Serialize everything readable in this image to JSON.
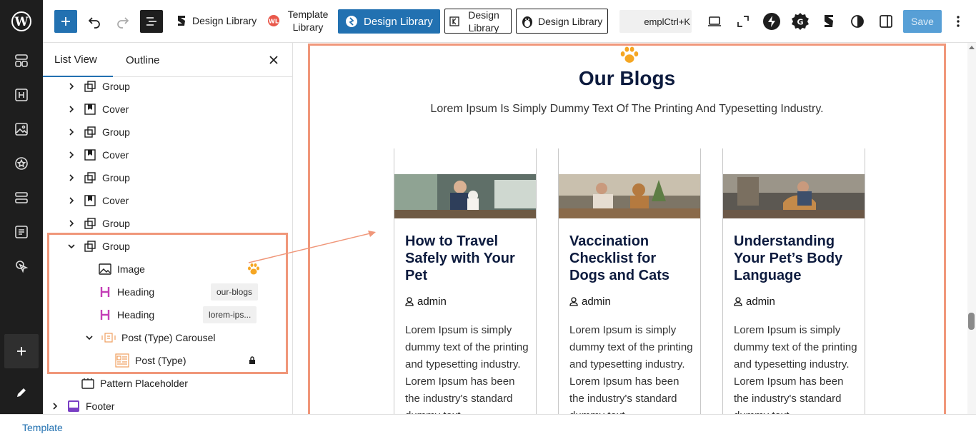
{
  "toolbar": {
    "design_library_1": "Design Library",
    "template_library": "Template Library",
    "design_library_blue": "Design Library",
    "design_library_box": "Design Library",
    "design_library_3": "Design Library",
    "search_text": "empl",
    "search_shortcut": "Ctrl+K",
    "save_label": "Save"
  },
  "list_view": {
    "tab_list": "List View",
    "tab_outline": "Outline",
    "items": [
      {
        "label": "Group",
        "icon": "group-icon"
      },
      {
        "label": "Cover",
        "icon": "cover-icon"
      },
      {
        "label": "Group",
        "icon": "group-icon"
      },
      {
        "label": "Cover",
        "icon": "cover-icon"
      },
      {
        "label": "Group",
        "icon": "group-icon"
      },
      {
        "label": "Cover",
        "icon": "cover-icon"
      },
      {
        "label": "Group",
        "icon": "group-icon"
      },
      {
        "label": "Group",
        "icon": "group-icon"
      },
      {
        "label": "Image",
        "icon": "image-icon"
      },
      {
        "label": "Heading",
        "icon": "heading-icon",
        "anchor": "our-blogs"
      },
      {
        "label": "Heading",
        "icon": "heading-icon",
        "anchor": "lorem-ips..."
      },
      {
        "label": "Post (Type) Carousel",
        "icon": "carousel-icon"
      },
      {
        "label": "Post (Type)",
        "icon": "post-type-icon"
      },
      {
        "label": "Pattern Placeholder",
        "icon": "pattern-icon"
      },
      {
        "label": "Footer",
        "icon": "footer-icon"
      }
    ]
  },
  "canvas": {
    "heading": "Our Blogs",
    "subheading": "Lorem Ipsum Is Simply Dummy Text Of The Printing And Typesetting Industry.",
    "cards": [
      {
        "title": "How to Travel Safely with Your Pet",
        "author": "admin",
        "excerpt": "Lorem Ipsum is simply dummy text of the printing and typesetting industry. Lorem Ipsum has been the industry's standard dummy text"
      },
      {
        "title": "Vaccination Checklist for Dogs and Cats",
        "author": "admin",
        "excerpt": "Lorem Ipsum is simply dummy text of the printing and typesetting industry. Lorem Ipsum has been the industry's standard dummy text"
      },
      {
        "title": "Understanding Your Pet’s Body Language",
        "author": "admin",
        "excerpt": "Lorem Ipsum is simply dummy text of the printing and typesetting industry. Lorem Ipsum has been the industry's standard dummy text"
      }
    ]
  },
  "status": {
    "breadcrumb": "Template"
  },
  "colors": {
    "accent": "#2271b1",
    "highlight": "#f0977a",
    "paw": "#f5a623",
    "title": "#0d1b3e"
  }
}
